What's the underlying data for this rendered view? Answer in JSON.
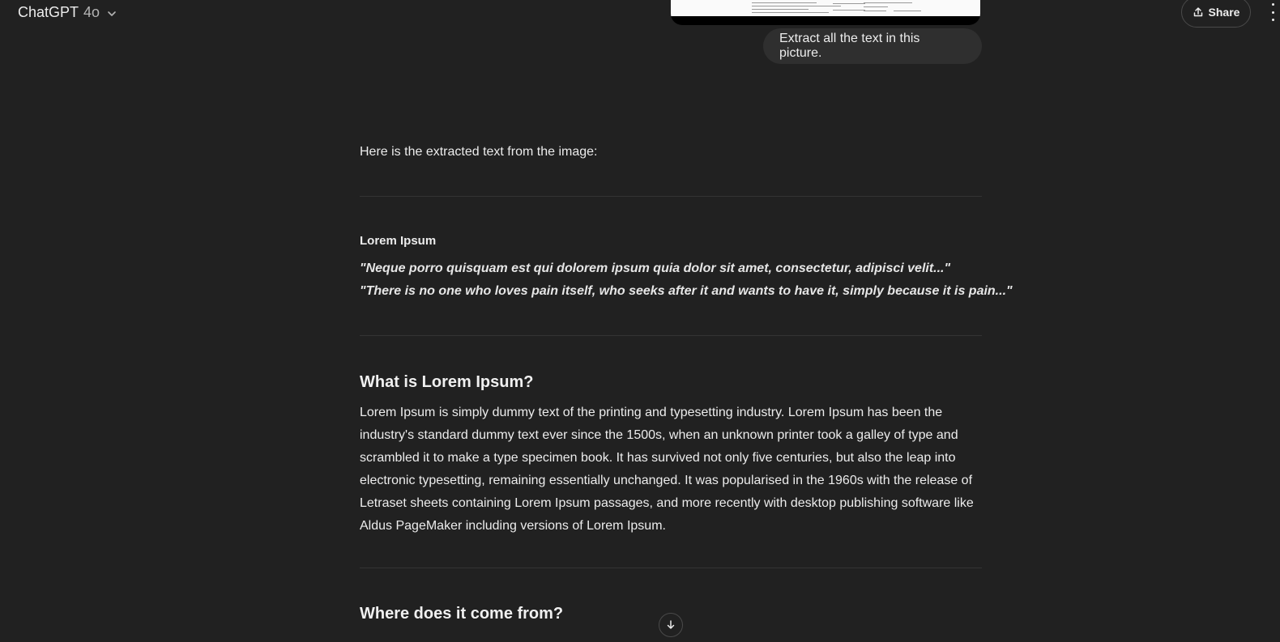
{
  "header": {
    "model_name": "ChatGPT",
    "model_version": "4o",
    "share_label": "Share"
  },
  "conversation": {
    "user_message": "Extract all the text in this picture.",
    "assistant": {
      "intro": "Here is the extracted text from the image:",
      "section1_title": "Lorem Ipsum",
      "quote1": "\"Neque porro quisquam est qui dolorem ipsum quia dolor sit amet, consectetur, adipisci velit...\"",
      "quote2": "\"There is no one who loves pain itself, who seeks after it and wants to have it, simply because it is pain...\"",
      "section2_title": "What is Lorem Ipsum?",
      "section2_body": "Lorem Ipsum is simply dummy text of the printing and typesetting industry. Lorem Ipsum has been the industry's standard dummy text ever since the 1500s, when an unknown printer took a galley of type and scrambled it to make a type specimen book. It has survived not only five centuries, but also the leap into electronic typesetting, remaining essentially unchanged. It was popularised in the 1960s with the release of Letraset sheets containing Lorem Ipsum passages, and more recently with desktop publishing software like Aldus PageMaker including versions of Lorem Ipsum.",
      "section3_title": "Where does it come from?"
    }
  },
  "icons": {
    "chevron": "chevron-down-icon",
    "share": "share-icon",
    "more": "more-vertical-icon",
    "scroll": "arrow-down-icon"
  }
}
